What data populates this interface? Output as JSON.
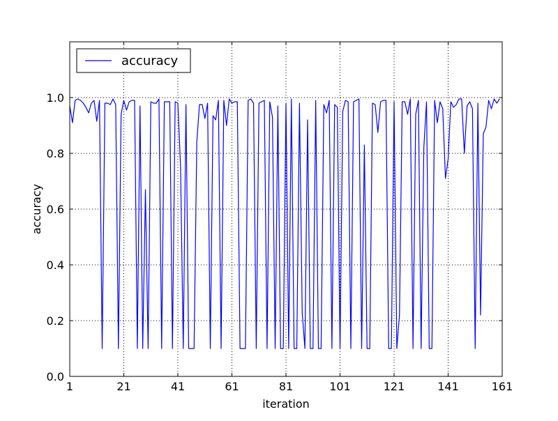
{
  "chart_data": {
    "type": "line",
    "title": "",
    "xlabel": "iteration",
    "ylabel": "accuracy",
    "xlim": [
      1,
      161
    ],
    "ylim": [
      0.0,
      1.2
    ],
    "xticks": [
      1,
      21,
      41,
      61,
      81,
      101,
      121,
      141,
      161
    ],
    "xtick_labels": [
      "1",
      "21",
      "41",
      "61",
      "81",
      "101",
      "121",
      "141",
      "161"
    ],
    "yticks": [
      0.0,
      0.2,
      0.4,
      0.6,
      0.8,
      1.0
    ],
    "ytick_labels": [
      "0.0",
      "0.2",
      "0.4",
      "0.6",
      "0.8",
      "1.0"
    ],
    "grid": true,
    "legend": {
      "placement": "top-left",
      "entries": [
        "accuracy"
      ]
    },
    "series": [
      {
        "name": "accuracy",
        "color": "#0000ff",
        "x_start": 1,
        "values": [
          0.97,
          0.91,
          0.99,
          0.995,
          0.99,
          0.98,
          0.965,
          0.945,
          0.98,
          0.99,
          0.915,
          0.99,
          0.1,
          0.98,
          0.98,
          0.975,
          0.995,
          0.975,
          0.1,
          0.94,
          0.99,
          0.955,
          0.985,
          0.99,
          0.99,
          0.1,
          0.97,
          0.1,
          0.67,
          0.1,
          0.985,
          0.98,
          0.98,
          0.995,
          0.1,
          0.985,
          0.985,
          0.985,
          0.1,
          0.985,
          0.98,
          0.75,
          0.1,
          0.975,
          0.1,
          0.1,
          0.1,
          0.84,
          0.975,
          0.975,
          0.925,
          0.98,
          0.1,
          0.935,
          0.92,
          0.99,
          0.1,
          0.99,
          0.9,
          0.995,
          0.98,
          0.985,
          0.985,
          0.1,
          0.1,
          0.1,
          0.99,
          0.995,
          0.98,
          0.1,
          0.98,
          0.985,
          0.99,
          0.1,
          0.985,
          0.93,
          0.1,
          0.97,
          0.1,
          0.1,
          0.98,
          0.1,
          0.995,
          0.1,
          0.1,
          0.98,
          0.23,
          0.1,
          0.92,
          0.1,
          0.1,
          0.99,
          0.1,
          0.1,
          0.975,
          0.945,
          0.99,
          0.1,
          0.975,
          0.965,
          0.1,
          0.95,
          0.99,
          0.985,
          0.1,
          0.985,
          0.99,
          0.995,
          0.1,
          0.83,
          0.1,
          0.1,
          0.98,
          0.975,
          0.875,
          0.985,
          0.99,
          0.99,
          0.1,
          0.1,
          0.985,
          0.1,
          0.22,
          0.985,
          0.985,
          0.94,
          0.995,
          0.1,
          0.94,
          0.99,
          0.1,
          0.82,
          0.985,
          0.1,
          0.1,
          0.99,
          0.91,
          0.985,
          0.96,
          0.71,
          0.78,
          0.985,
          0.965,
          0.975,
          0.995,
          0.995,
          0.8,
          0.97,
          0.985,
          0.96,
          0.1,
          0.98,
          0.22,
          0.87,
          0.895,
          0.99,
          0.96,
          0.995,
          0.98,
          0.995
        ]
      }
    ]
  }
}
